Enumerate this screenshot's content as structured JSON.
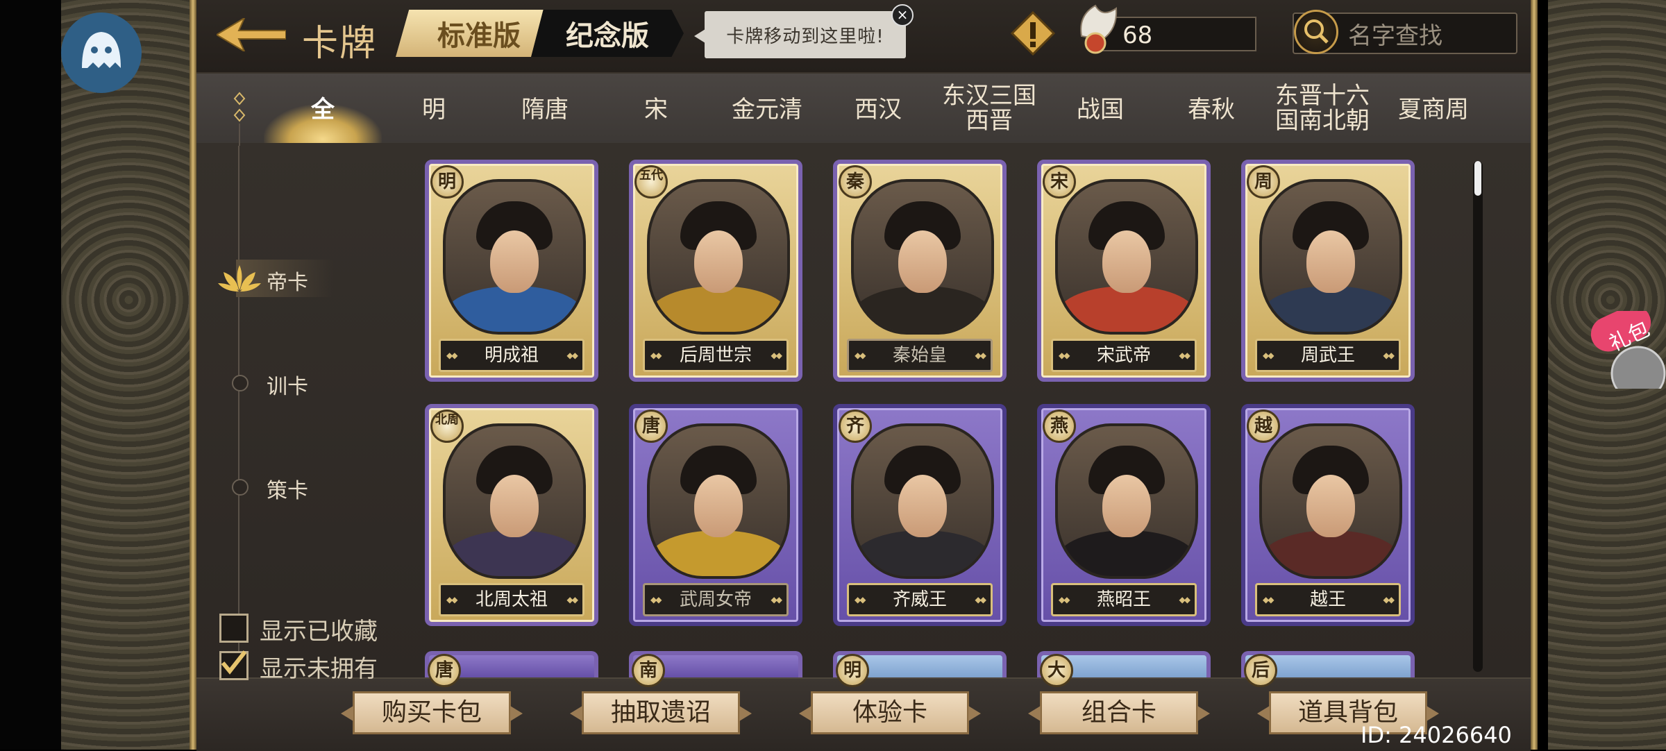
{
  "header": {
    "title": "卡牌",
    "tabs": [
      {
        "label": "标准版",
        "active": true
      },
      {
        "label": "纪念版",
        "active": false
      }
    ],
    "tooltip": "卡牌移动到这里啦!",
    "resource_count": "68",
    "search_placeholder": "名字查找"
  },
  "categories": [
    "全",
    "明",
    "隋唐",
    "宋",
    "金元清",
    "西汉",
    "东汉三国\n西晋",
    "战国",
    "春秋",
    "东晋十六\n国南北朝",
    "夏商周"
  ],
  "categories_split": [
    [
      "全"
    ],
    [
      "明"
    ],
    [
      "隋唐"
    ],
    [
      "宋"
    ],
    [
      "金元清"
    ],
    [
      "西汉"
    ],
    [
      "东汉三国",
      "西晋"
    ],
    [
      "战国"
    ],
    [
      "春秋"
    ],
    [
      "东晋十六",
      "国南北朝"
    ],
    [
      "夏商周"
    ]
  ],
  "active_category": "全",
  "sidebar": {
    "items": [
      {
        "label": "帝卡",
        "active": true
      },
      {
        "label": "训卡",
        "active": false
      },
      {
        "label": "策卡",
        "active": false
      }
    ],
    "filters": [
      {
        "label": "显示已收藏",
        "checked": false
      },
      {
        "label": "显示未拥有",
        "checked": true
      }
    ]
  },
  "cards": [
    {
      "name": "明成祖",
      "dynasty": "明",
      "style": "gold",
      "robe": "#2f5d9e",
      "dim": false
    },
    {
      "name": "后周世宗",
      "dynasty": "五代",
      "style": "gold",
      "robe": "#b78a2c",
      "dim": false
    },
    {
      "name": "秦始皇",
      "dynasty": "秦",
      "style": "gold",
      "robe": "#2a2520",
      "dim": true
    },
    {
      "name": "宋武帝",
      "dynasty": "宋",
      "style": "gold",
      "robe": "#b8402c",
      "dim": false
    },
    {
      "name": "周武王",
      "dynasty": "周",
      "style": "gold",
      "robe": "#2e3a52",
      "dim": false
    },
    {
      "name": "北周太祖",
      "dynasty": "北周",
      "style": "gold",
      "robe": "#3d3552",
      "dim": false
    },
    {
      "name": "武周女帝",
      "dynasty": "唐",
      "style": "purple",
      "robe": "#c59a2e",
      "dim": true
    },
    {
      "name": "齐威王",
      "dynasty": "齐",
      "style": "purple",
      "robe": "#2c2a2e",
      "dim": false
    },
    {
      "name": "燕昭王",
      "dynasty": "燕",
      "style": "purple",
      "robe": "#1e1b1c",
      "dim": false
    },
    {
      "name": "越王",
      "dynasty": "越",
      "style": "purple",
      "robe": "#5a2a26",
      "dim": false
    }
  ],
  "partial_cards": [
    "唐",
    "南",
    "明",
    "大",
    "后"
  ],
  "bottom_buttons": [
    "购买卡包",
    "抽取遗诏",
    "体验卡",
    "组合卡",
    "道具背包"
  ],
  "user_id": "ID: 24026640",
  "gift_label": "礼包",
  "colors": {
    "accent_gold": "#d9bf7c",
    "background": "#2b2622"
  }
}
